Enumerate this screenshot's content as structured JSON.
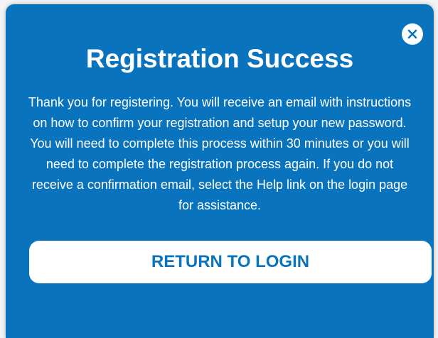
{
  "dialog": {
    "title": "Registration Success",
    "message": "Thank you for registering. You will receive an email with instructions on how to confirm your registration and setup your new password. You will need to complete this process within 30 minutes or you will need to complete the registration process again. If you do not receive a confirmation email, select the Help link on the login page for assistance.",
    "return_button_label": "RETURN TO LOGIN",
    "close_icon": "close-icon"
  },
  "colors": {
    "dialog_background": "#0a73bd",
    "button_background": "#ffffff",
    "button_text": "#0a73bd",
    "text": "#ffffff"
  }
}
